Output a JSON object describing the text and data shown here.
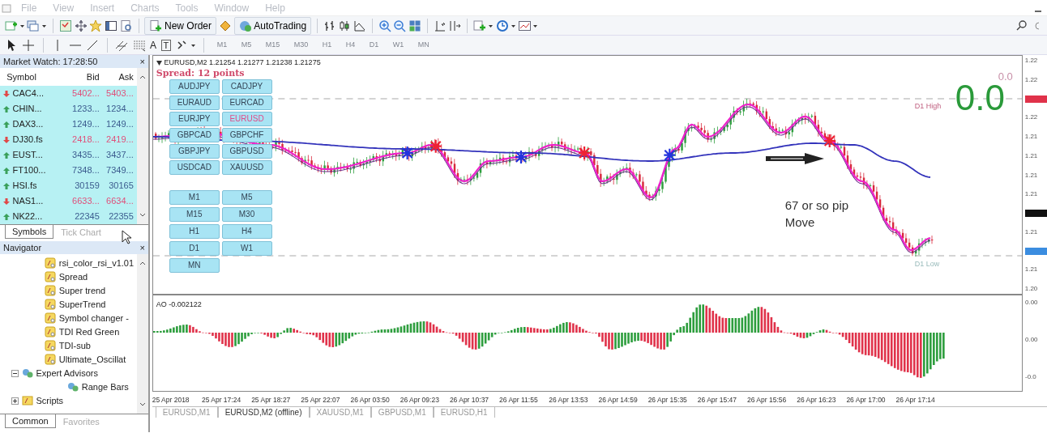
{
  "menu": [
    "File",
    "View",
    "Insert",
    "Charts",
    "Tools",
    "Window",
    "Help"
  ],
  "toolbar": {
    "new_order": "New Order",
    "autotrading": "AutoTrading",
    "text_tool": "A",
    "label_tool": "T"
  },
  "periods": [
    {
      "label": "M1",
      "disabled": true
    },
    {
      "label": "M5",
      "disabled": true
    },
    {
      "label": "M15",
      "disabled": true
    },
    {
      "label": "M30",
      "disabled": true
    },
    {
      "label": "H1",
      "disabled": true
    },
    {
      "label": "H4",
      "disabled": true
    },
    {
      "label": "D1",
      "disabled": true
    },
    {
      "label": "W1",
      "disabled": true
    },
    {
      "label": "MN",
      "disabled": true
    }
  ],
  "market_watch": {
    "title": "Market Watch: 17:28:50",
    "close": "×",
    "columns": [
      "Symbol",
      "Bid",
      "Ask"
    ],
    "rows": [
      {
        "symbol": "CAC4...",
        "bid": "5402...",
        "ask": "5403...",
        "down": true
      },
      {
        "symbol": "CHIN...",
        "bid": "1233...",
        "ask": "1234...",
        "down": false
      },
      {
        "symbol": "DAX3...",
        "bid": "1249...",
        "ask": "1249...",
        "down": false
      },
      {
        "symbol": "DJ30.fs",
        "bid": "2418...",
        "ask": "2419...",
        "down": true
      },
      {
        "symbol": "EUST...",
        "bid": "3435...",
        "ask": "3437...",
        "down": false
      },
      {
        "symbol": "FT100...",
        "bid": "7348...",
        "ask": "7349...",
        "down": false
      },
      {
        "symbol": "HSI.fs",
        "bid": "30159",
        "ask": "30165",
        "down": false
      },
      {
        "symbol": "NAS1...",
        "bid": "6633...",
        "ask": "6634...",
        "down": true
      },
      {
        "symbol": "NK22...",
        "bid": "22345",
        "ask": "22355",
        "down": false
      }
    ],
    "tabs": [
      {
        "label": "Symbols",
        "selected": true
      },
      {
        "label": "Tick Chart",
        "selected": false
      }
    ]
  },
  "navigator": {
    "title": "Navigator",
    "close": "×",
    "items": [
      {
        "label": "rsi_color_rsi_v1.01",
        "kind": "indicator"
      },
      {
        "label": "Spread",
        "kind": "indicator"
      },
      {
        "label": "Super trend",
        "kind": "indicator"
      },
      {
        "label": "SuperTrend",
        "kind": "indicator"
      },
      {
        "label": "Symbol changer -",
        "kind": "indicator"
      },
      {
        "label": "TDI Red Green",
        "kind": "indicator"
      },
      {
        "label": "TDI-sub",
        "kind": "indicator"
      },
      {
        "label": "Ultimate_Oscillat",
        "kind": "indicator"
      },
      {
        "label": "Expert Advisors",
        "kind": "folder",
        "expanded": true,
        "children": [
          {
            "label": "Range Bars",
            "kind": "expert"
          }
        ]
      },
      {
        "label": "Scripts",
        "kind": "folder",
        "expanded": false
      }
    ],
    "tabs": [
      {
        "label": "Common",
        "selected": true
      },
      {
        "label": "Favorites",
        "selected": false
      }
    ]
  },
  "chart": {
    "header": "EURUSD,M2  1.21254 1.21277 1.21238 1.21275",
    "spread": "Spread: 12 points",
    "symbols": [
      {
        "label": "AUDJPY",
        "selected": false
      },
      {
        "label": "CADJPY",
        "selected": false
      },
      {
        "label": "EURAUD",
        "selected": false
      },
      {
        "label": "EURCAD",
        "selected": false
      },
      {
        "label": "EURJPY",
        "selected": false
      },
      {
        "label": "EURUSD",
        "selected": true
      },
      {
        "label": "GBPCAD",
        "selected": false
      },
      {
        "label": "GBPCHF",
        "selected": false
      },
      {
        "label": "GBPJPY",
        "selected": false
      },
      {
        "label": "GBPUSD",
        "selected": false
      },
      {
        "label": "USDCAD",
        "selected": false
      },
      {
        "label": "XAUUSD",
        "selected": false
      }
    ],
    "timeframes": [
      "M1",
      "M5",
      "M15",
      "M30",
      "H1",
      "H4",
      "D1",
      "W1",
      "MN"
    ],
    "d1_high": "D1 High",
    "d1_low": "D1 Low",
    "small_value": "0.0",
    "big_value": "0.0",
    "note": "67 or so pip\nMove",
    "price_axis": [
      {
        "kind": "label",
        "text": "1.22"
      },
      {
        "kind": "label",
        "text": "1.22"
      },
      {
        "kind": "tag",
        "color": "#e0324a"
      },
      {
        "kind": "label",
        "text": "1.22"
      },
      {
        "kind": "label",
        "text": "1.21"
      },
      {
        "kind": "label",
        "text": "1.21"
      },
      {
        "kind": "label",
        "text": "1.21"
      },
      {
        "kind": "label",
        "text": "1.21"
      },
      {
        "kind": "tag",
        "color": "#111111"
      },
      {
        "kind": "label",
        "text": "1.21"
      },
      {
        "kind": "tag",
        "color": "#3b8de0"
      },
      {
        "kind": "label",
        "text": "1.21"
      },
      {
        "kind": "label",
        "text": "1.20"
      }
    ]
  },
  "indicator": {
    "label": "AO -0.002122",
    "axis": [
      "0.00",
      "0.00",
      "-0.0"
    ]
  },
  "time_axis": [
    "25 Apr 2018",
    "25 Apr 17:24",
    "25 Apr 18:27",
    "25 Apr 22:07",
    "26 Apr 03:50",
    "26 Apr 09:23",
    "26 Apr 10:37",
    "26 Apr 11:55",
    "26 Apr 13:53",
    "26 Apr 14:59",
    "26 Apr 15:35",
    "26 Apr 15:47",
    "26 Apr 15:56",
    "26 Apr 16:23",
    "26 Apr 17:00",
    "26 Apr 17:14"
  ],
  "chart_tabs": [
    {
      "label": "EURUSD,M1",
      "selected": false
    },
    {
      "label": "EURUSD,M2 (offline)",
      "selected": true
    },
    {
      "label": "XAUUSD,M1",
      "selected": false
    },
    {
      "label": "GBPUSD,M1",
      "selected": false
    },
    {
      "label": "EURUSD,H1",
      "selected": false
    }
  ]
}
